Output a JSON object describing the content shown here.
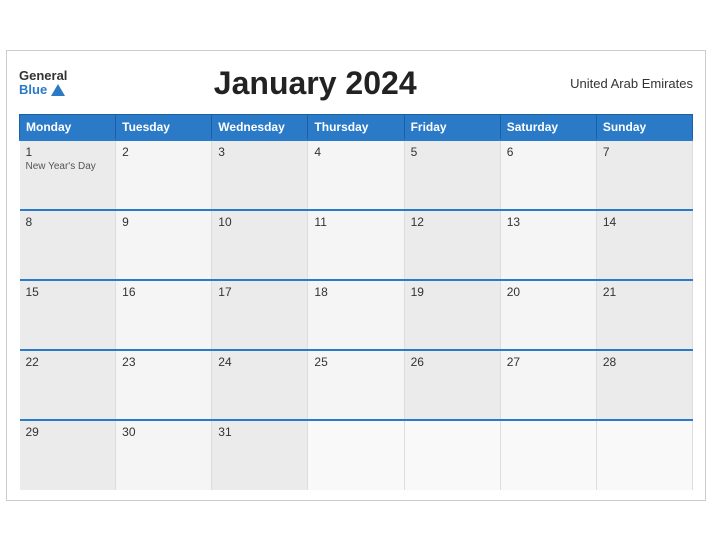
{
  "header": {
    "logo_general": "General",
    "logo_blue": "Blue",
    "title": "January 2024",
    "country": "United Arab Emirates"
  },
  "weekdays": [
    "Monday",
    "Tuesday",
    "Wednesday",
    "Thursday",
    "Friday",
    "Saturday",
    "Sunday"
  ],
  "weeks": [
    [
      {
        "day": "1",
        "event": "New Year's Day"
      },
      {
        "day": "2",
        "event": ""
      },
      {
        "day": "3",
        "event": ""
      },
      {
        "day": "4",
        "event": ""
      },
      {
        "day": "5",
        "event": ""
      },
      {
        "day": "6",
        "event": ""
      },
      {
        "day": "7",
        "event": ""
      }
    ],
    [
      {
        "day": "8",
        "event": ""
      },
      {
        "day": "9",
        "event": ""
      },
      {
        "day": "10",
        "event": ""
      },
      {
        "day": "11",
        "event": ""
      },
      {
        "day": "12",
        "event": ""
      },
      {
        "day": "13",
        "event": ""
      },
      {
        "day": "14",
        "event": ""
      }
    ],
    [
      {
        "day": "15",
        "event": ""
      },
      {
        "day": "16",
        "event": ""
      },
      {
        "day": "17",
        "event": ""
      },
      {
        "day": "18",
        "event": ""
      },
      {
        "day": "19",
        "event": ""
      },
      {
        "day": "20",
        "event": ""
      },
      {
        "day": "21",
        "event": ""
      }
    ],
    [
      {
        "day": "22",
        "event": ""
      },
      {
        "day": "23",
        "event": ""
      },
      {
        "day": "24",
        "event": ""
      },
      {
        "day": "25",
        "event": ""
      },
      {
        "day": "26",
        "event": ""
      },
      {
        "day": "27",
        "event": ""
      },
      {
        "day": "28",
        "event": ""
      }
    ],
    [
      {
        "day": "29",
        "event": ""
      },
      {
        "day": "30",
        "event": ""
      },
      {
        "day": "31",
        "event": ""
      },
      {
        "day": "",
        "event": ""
      },
      {
        "day": "",
        "event": ""
      },
      {
        "day": "",
        "event": ""
      },
      {
        "day": "",
        "event": ""
      }
    ]
  ]
}
